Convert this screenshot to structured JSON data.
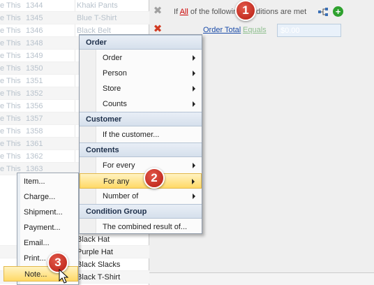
{
  "grid": {
    "rows": [
      {
        "c1": "e This",
        "c2": "1344",
        "c3": "Khaki Pants"
      },
      {
        "c1": "e This",
        "c2": "1345",
        "c3": "Blue T-Shirt"
      },
      {
        "c1": "e This",
        "c2": "1346",
        "c3": "Black Belt"
      },
      {
        "c1": "e This",
        "c2": "1348",
        "c3": ""
      },
      {
        "c1": "e This",
        "c2": "1349",
        "c3": ""
      },
      {
        "c1": "e This",
        "c2": "1350",
        "c3": ""
      },
      {
        "c1": "e This",
        "c2": "1351",
        "c3": ""
      },
      {
        "c1": "e This",
        "c2": "1352",
        "c3": ""
      },
      {
        "c1": "e This",
        "c2": "1356",
        "c3": ""
      },
      {
        "c1": "e This",
        "c2": "1357",
        "c3": ""
      },
      {
        "c1": "e This",
        "c2": "1358",
        "c3": ""
      },
      {
        "c1": "e This",
        "c2": "1361",
        "c3": ""
      },
      {
        "c1": "e This",
        "c2": "1362",
        "c3": ""
      },
      {
        "c1": "e This",
        "c2": "1363",
        "c3": ""
      }
    ],
    "bottom_rows": [
      {
        "c3": "Black Hat"
      },
      {
        "c3": "Purple Hat"
      },
      {
        "c3": "Black Slacks"
      },
      {
        "c3": "Black T-Shirt"
      }
    ]
  },
  "conditions": {
    "header_prefix": "If",
    "header_all": "All",
    "header_suffix": "of the following conditions are met",
    "row": {
      "field": "Order Total",
      "operator": "Equals",
      "value": "$0.00"
    }
  },
  "menu": {
    "sections": [
      {
        "header": "Order",
        "items": [
          {
            "label": "Order",
            "submenu": true
          },
          {
            "label": "Person",
            "submenu": true
          },
          {
            "label": "Store",
            "submenu": true
          },
          {
            "label": "Counts",
            "submenu": true
          }
        ]
      },
      {
        "header": "Customer",
        "items": [
          {
            "label": "If the customer...",
            "submenu": false
          }
        ]
      },
      {
        "header": "Contents",
        "items": [
          {
            "label": "For every",
            "submenu": true
          },
          {
            "label": "For any",
            "submenu": true,
            "highlighted": true
          },
          {
            "label": "Number of",
            "submenu": true
          }
        ]
      },
      {
        "header": "Condition Group",
        "items": [
          {
            "label": "The combined result of...",
            "submenu": false
          }
        ]
      }
    ]
  },
  "submenu": {
    "items": [
      {
        "label": "Item..."
      },
      {
        "label": "Charge..."
      },
      {
        "label": "Shipment..."
      },
      {
        "label": "Payment..."
      },
      {
        "label": "Email..."
      },
      {
        "label": "Print..."
      },
      {
        "label": "Note...",
        "highlighted": true
      }
    ]
  },
  "callouts": [
    "1",
    "2",
    "3"
  ],
  "colors": {
    "highlight": "#ffd966",
    "header_bg": "#d6e0ec",
    "callout": "#c62a1d",
    "link": "#1a4ba8",
    "remove_icon": "#d13a22"
  },
  "icons": [
    "remove-icon",
    "tree-icon",
    "add-icon",
    "submenu-arrow-icon",
    "mouse-cursor-icon"
  ]
}
